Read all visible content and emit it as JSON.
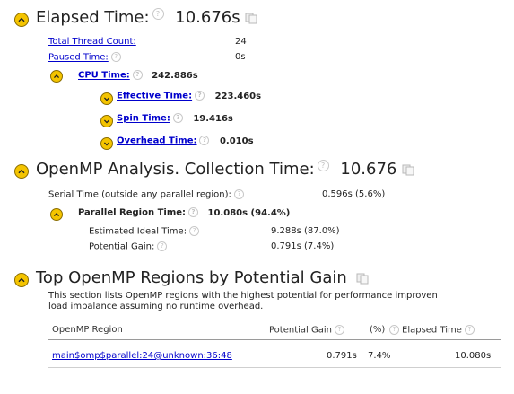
{
  "elapsed": {
    "title": "Elapsed Time:",
    "value": "10.676s",
    "total_thread_label": "Total Thread Count:",
    "total_thread_value": "24",
    "paused_label": "Paused Time:",
    "paused_value": "0s",
    "cpu_label": "CPU Time:",
    "cpu_value": "242.886s",
    "effective_label": "Effective Time:",
    "effective_value": "223.460s",
    "spin_label": "Spin Time:",
    "spin_value": "19.416s",
    "overhead_label": "Overhead Time:",
    "overhead_value": "0.010s"
  },
  "openmp": {
    "title": "OpenMP Analysis. Collection Time:",
    "value": "10.676",
    "serial_label": "Serial Time (outside any parallel region):",
    "serial_value": "0.596s (5.6%)",
    "parallel_label": "Parallel Region Time:",
    "parallel_value": "10.080s (94.4%)",
    "ideal_label": "Estimated Ideal Time:",
    "ideal_value": "9.288s (87.0%)",
    "gain_label": "Potential Gain:",
    "gain_value": "0.791s (7.4%)"
  },
  "top_regions": {
    "title": "Top OpenMP Regions by Potential Gain",
    "desc_line1": "This section lists OpenMP regions with the highest potential for performance improven",
    "desc_line2": "load imbalance assuming no runtime overhead.",
    "col_region": "OpenMP Region",
    "col_gain": "Potential Gain",
    "col_pct": "(%)",
    "col_elapsed": "Elapsed Time",
    "rows": [
      {
        "region": "main$omp$parallel:24@unknown:36:48",
        "gain": "0.791s",
        "pct": "7.4%",
        "elapsed": "10.080s"
      }
    ]
  },
  "icons": {
    "toggle": "collapse-toggle-icon",
    "help": "help-icon",
    "copy": "copy-icon"
  },
  "colors": {
    "toggle_fill": "#f4c400",
    "link": "#0000cc"
  }
}
